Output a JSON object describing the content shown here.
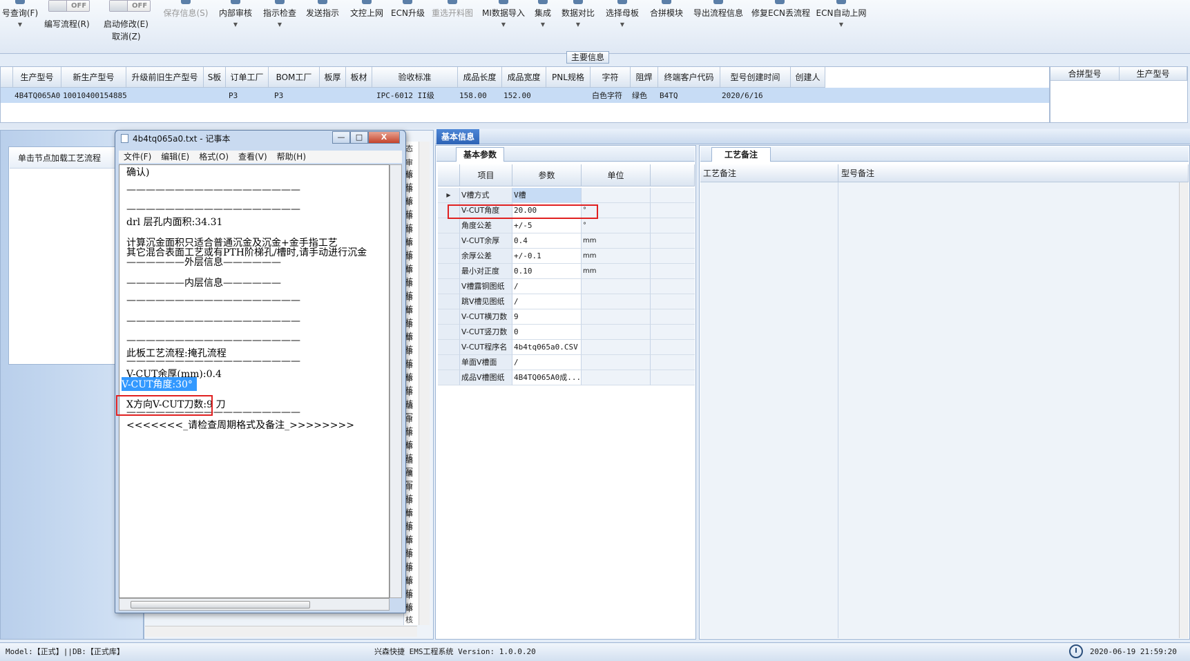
{
  "ribbon": {
    "query_label": "号查询(F)",
    "write_flow_toggle": "OFF",
    "write_flow_label": "编写流程(R)",
    "auto_modify_toggle": "OFF",
    "auto_modify_label": "启动修改(E)",
    "cancel_label": "取消(Z)",
    "buttons": [
      {
        "label": "保存信息(S)",
        "disabled": true
      },
      {
        "label": "内部审核"
      },
      {
        "label": "指示检查"
      },
      {
        "label": "发送指示"
      },
      {
        "label": "文控上网"
      },
      {
        "label": "ECN升级"
      },
      {
        "label": "重选开料图",
        "disabled": true
      },
      {
        "label": "MI数据导入"
      },
      {
        "label": "集成"
      },
      {
        "label": "数据对比"
      },
      {
        "label": "选择母板"
      },
      {
        "label": "合拼模块"
      },
      {
        "label": "导出流程信息"
      },
      {
        "label": "修复ECN丢流程"
      },
      {
        "label": "ECN自动上网"
      }
    ]
  },
  "main_info": {
    "section_title": "主要信息",
    "columns": [
      "生产型号",
      "新生产型号",
      "升级前旧生产型号",
      "S板",
      "订单工厂",
      "BOM工厂",
      "板厚",
      "板材",
      "验收标准",
      "成品长度",
      "成品宽度",
      "PNL规格",
      "字符",
      "阻焊",
      "终端客户代码",
      "型号创建时间",
      "创建人"
    ],
    "row": [
      "4B4TQ065A0",
      "10010400154885",
      "",
      "",
      "P3",
      "P3",
      "",
      "",
      "IPC-6012 II级",
      "158.00",
      "152.00",
      "",
      "白色字符",
      "绿色",
      "B4TQ",
      "2020/6/16",
      ""
    ],
    "merge_columns": [
      "合拼型号",
      "生产型号"
    ]
  },
  "left_panel": {
    "tree_hint": "单击节点加载工艺流程"
  },
  "mid_panel": {
    "column_text": [
      "态",
      "审核",
      "审核",
      "审核",
      "审核",
      "审核",
      "审核",
      "审核",
      "审核",
      "审核",
      "审核",
      "审核",
      "审核",
      "审核",
      "审核",
      "审核",
      "审核",
      "审核",
      "审核",
      "编写",
      "审核",
      "审核",
      "审核",
      "编写",
      "编写",
      "审核",
      "审核",
      "审核",
      "审核",
      "审核",
      "审核",
      "审核",
      "审核",
      "审核",
      "审核"
    ]
  },
  "notepad": {
    "title": "4b4tq065a0.txt - 记事本",
    "menu": [
      "文件(F)",
      "编辑(E)",
      "格式(O)",
      "查看(V)",
      "帮助(H)"
    ],
    "lines": [
      "确认)",
      "——————————————————",
      "——————————————————",
      "drl          层孔内面积:34.31",
      "计算沉金面积只适合普通沉金及沉金+金手指工艺",
      "其它混合表面工艺或有PTH阶梯孔/槽时,请手动进行沉金",
      "——————外层信息——————",
      "——————内层信息——————",
      "——————————————————",
      "——————————————————",
      "——————————————————",
      "此板工艺流程:掩孔流程",
      "——————————————————",
      "V-CUT余厚(mm):0.4",
      "V-CUT角度:30°",
      "X方向V-CUT刀数:9 刀",
      "——————————————————",
      "<<<<<<<_请检查周期格式及备注_>>>>>>>>"
    ],
    "minimize": "—",
    "maximize": "□",
    "close": "X"
  },
  "basic_info": {
    "tab": "基本信息",
    "param_tab": "基本参数",
    "columns": [
      "项目",
      "参数",
      "单位"
    ],
    "rows": [
      {
        "name": "V槽方式",
        "value": "V槽",
        "unit": ""
      },
      {
        "name": "V-CUT角度",
        "value": "20.00",
        "unit": "°"
      },
      {
        "name": "角度公差",
        "value": "+/-5",
        "unit": "°"
      },
      {
        "name": "V-CUT余厚",
        "value": "0.4",
        "unit": "mm"
      },
      {
        "name": "余厚公差",
        "value": "+/-0.1",
        "unit": "mm"
      },
      {
        "name": "最小对正度",
        "value": "0.10",
        "unit": "mm"
      },
      {
        "name": "V槽露铜图纸",
        "value": "/",
        "unit": ""
      },
      {
        "name": "跳V槽见图纸",
        "value": "/",
        "unit": ""
      },
      {
        "name": "V-CUT横刀数",
        "value": "9",
        "unit": ""
      },
      {
        "name": "V-CUT竖刀数",
        "value": "0",
        "unit": ""
      },
      {
        "name": "V-CUT程序名",
        "value": "4b4tq065a0.CSV",
        "unit": ""
      },
      {
        "name": "单面V槽面",
        "value": "/",
        "unit": ""
      },
      {
        "name": "成品V槽图纸",
        "value": "4B4TQ065A0成...",
        "unit": ""
      }
    ]
  },
  "process_notes": {
    "tab": "工艺备注",
    "col1": "工艺备注",
    "col2": "型号备注"
  },
  "status_bar": {
    "model": "Model:【正式】||DB:【正式库】",
    "system": "兴森快捷 EMS工程系统 Version: 1.0.0.20",
    "datetime": "2020-06-19 21:59:20"
  }
}
